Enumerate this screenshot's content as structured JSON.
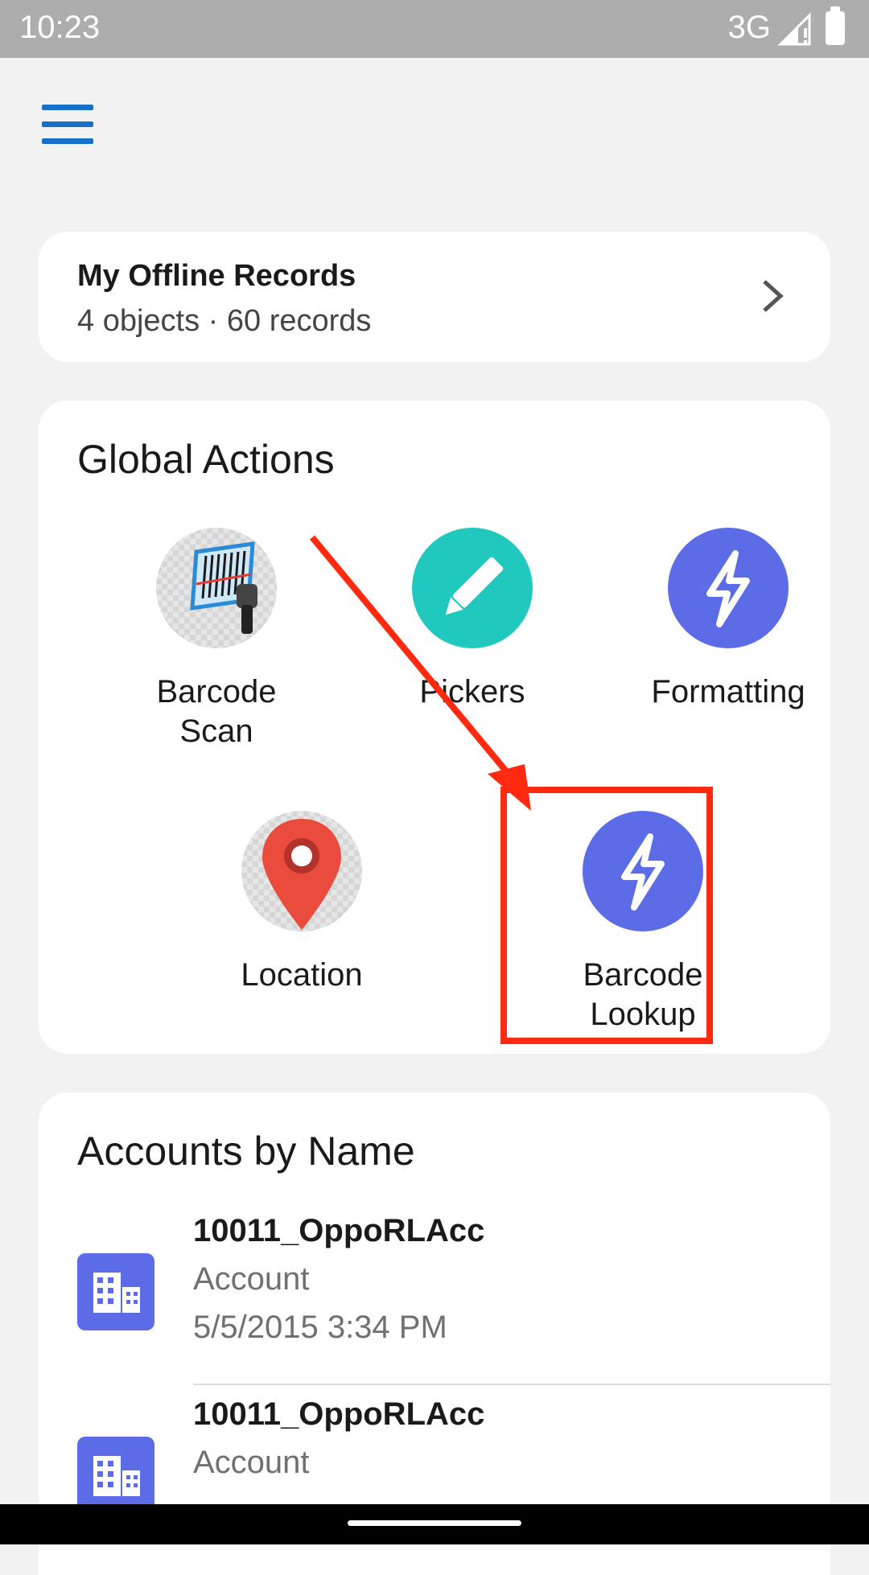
{
  "status_bar": {
    "time": "10:23",
    "network": "3G"
  },
  "offline_records": {
    "title": "My Offline Records",
    "subtitle": "4 objects · 60 records"
  },
  "global_actions": {
    "heading": "Global Actions",
    "items": [
      {
        "label_line1": "Barcode",
        "label_line2": "Scan",
        "icon": "barcode-scanner-icon"
      },
      {
        "label_line1": "Pickers",
        "label_line2": "",
        "icon": "pencil-icon"
      },
      {
        "label_line1": "Formatting",
        "label_line2": "",
        "icon": "lightning-icon"
      },
      {
        "label_line1": "Location",
        "label_line2": "",
        "icon": "map-pin-icon"
      },
      {
        "label_line1": "Barcode",
        "label_line2": "Lookup",
        "icon": "lightning-icon"
      }
    ]
  },
  "accounts": {
    "heading": "Accounts by Name",
    "rows": [
      {
        "name": "10011_OppoRLAcc",
        "type": "Account",
        "date": "5/5/2015 3:34 PM"
      },
      {
        "name": "10011_OppoRLAcc",
        "type": "Account"
      }
    ]
  },
  "colors": {
    "accent_blue": "#5c6be6",
    "teal": "#20c8bd",
    "menu_blue": "#1670c8",
    "highlight_red": "#ff2a10"
  }
}
